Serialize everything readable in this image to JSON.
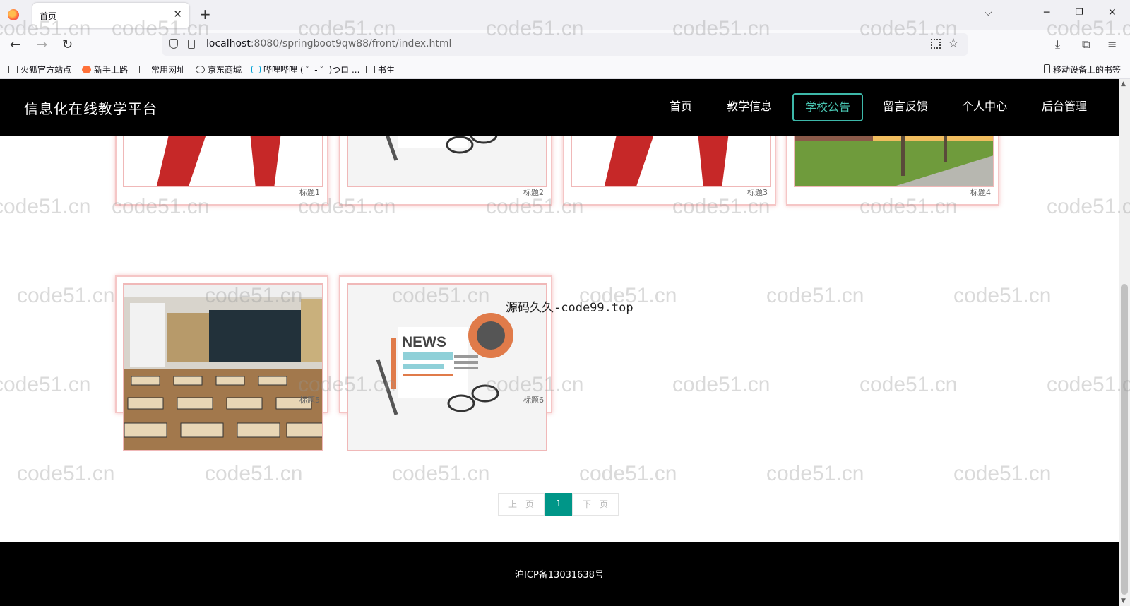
{
  "browser": {
    "tab_title": "首页",
    "url_host": "localhost",
    "url_rest": ":8080/springboot9qw88/front/index.html",
    "bookmarks": [
      "火狐官方站点",
      "新手上路",
      "常用网址",
      "京东商城",
      "哔哩哔哩 ( ゜- ゜)つロ ...",
      "书生"
    ],
    "mobile_bookmarks": "移动设备上的书签"
  },
  "site": {
    "title": "信息化在线教学平台",
    "nav": [
      "首页",
      "教学信息",
      "学校公告",
      "留言反馈",
      "个人中心",
      "后台管理"
    ],
    "active_nav": "学校公告",
    "accent": "#009688"
  },
  "cards": [
    {
      "caption": "标题1",
      "image": "news-mic-live"
    },
    {
      "caption": "标题2",
      "image": "news-paper-glasses"
    },
    {
      "caption": "标题3",
      "image": "news-mic-live"
    },
    {
      "caption": "标题4",
      "image": "campus-street"
    },
    {
      "caption": "标题5",
      "image": "classroom"
    },
    {
      "caption": "标题6",
      "image": "news-paper-glasses"
    }
  ],
  "overlay_text": "源码久久-code99.top",
  "pagination": {
    "prev": "上一页",
    "current": "1",
    "next": "下一页"
  },
  "footer": {
    "icp": "沪ICP备13031638号"
  },
  "watermark": "code51.cn"
}
